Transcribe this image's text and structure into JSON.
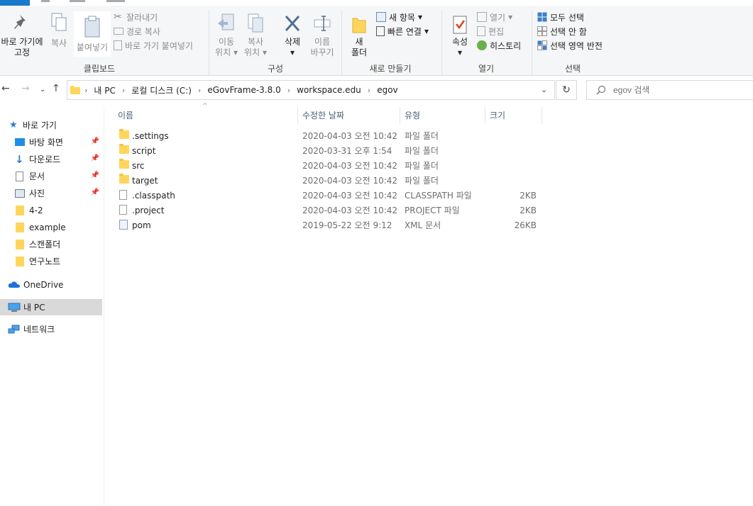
{
  "ribbon": {
    "clipboard": {
      "pin_label_1": "바로 가기에",
      "pin_label_2": "고정",
      "copy": "복사",
      "paste": "붙여넣기",
      "cut": "잘라내기",
      "copy_path": "경로 복사",
      "paste_shortcut": "바로 가기 붙여넣기",
      "group_label": "클립보드"
    },
    "organize": {
      "move_to_1": "이동",
      "move_to_2": "위치",
      "copy_to_1": "복사",
      "copy_to_2": "위치",
      "delete": "삭제",
      "rename_1": "이름",
      "rename_2": "바꾸기",
      "group_label": "구성"
    },
    "new": {
      "new_folder_1": "새",
      "new_folder_2": "폴더",
      "new_item": "새 항목",
      "easy_access": "빠른 연결",
      "group_label": "새로 만들기"
    },
    "open": {
      "properties": "속성",
      "open": "열기",
      "edit": "편집",
      "history": "히스토리",
      "group_label": "열기"
    },
    "select": {
      "select_all": "모두 선택",
      "select_none": "선택 안 함",
      "invert": "선택 영역 반전",
      "group_label": "선택"
    }
  },
  "address": {
    "crumbs": [
      "내 PC",
      "로컬 디스크 (C:)",
      "eGovFrame-3.8.0",
      "workspace.edu",
      "egov"
    ],
    "refresh_icon": "refresh-icon"
  },
  "search": {
    "placeholder": "egov 검색"
  },
  "nav": {
    "quick_access": "바로 가기",
    "items": [
      {
        "label": "바탕 화면",
        "pinned": true
      },
      {
        "label": "다운로드",
        "pinned": true
      },
      {
        "label": "문서",
        "pinned": true
      },
      {
        "label": "사진",
        "pinned": true
      },
      {
        "label": "4-2",
        "pinned": false
      },
      {
        "label": "example",
        "pinned": false
      },
      {
        "label": "스캔폴더",
        "pinned": false
      },
      {
        "label": "연구노트",
        "pinned": false
      }
    ],
    "onedrive": "OneDrive",
    "this_pc": "내 PC",
    "network": "네트워크"
  },
  "columns": {
    "name": "이름",
    "date": "수정한 날짜",
    "type": "유형",
    "size": "크기"
  },
  "files": [
    {
      "name": ".settings",
      "date": "2020-04-03 오전 10:42",
      "type": "파일 폴더",
      "size": "",
      "kind": "folder"
    },
    {
      "name": "script",
      "date": "2020-03-31 오후 1:54",
      "type": "파일 폴더",
      "size": "",
      "kind": "folder"
    },
    {
      "name": "src",
      "date": "2020-04-03 오전 10:42",
      "type": "파일 폴더",
      "size": "",
      "kind": "folder"
    },
    {
      "name": "target",
      "date": "2020-04-03 오전 10:42",
      "type": "파일 폴더",
      "size": "",
      "kind": "folder"
    },
    {
      "name": ".classpath",
      "date": "2020-04-03 오전 10:42",
      "type": "CLASSPATH 파일",
      "size": "2KB",
      "kind": "file"
    },
    {
      "name": ".project",
      "date": "2020-04-03 오전 10:42",
      "type": "PROJECT 파일",
      "size": "2KB",
      "kind": "file"
    },
    {
      "name": "pom",
      "date": "2019-05-22 오전 9:12",
      "type": "XML 문서",
      "size": "26KB",
      "kind": "xml"
    }
  ],
  "colors": {
    "accent": "#1979ca",
    "folder": "#ffd55c",
    "selected": "#d9d9d9"
  }
}
